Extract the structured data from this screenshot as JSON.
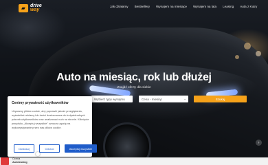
{
  "brand": {
    "line1": "drive",
    "line2": "way"
  },
  "nav": {
    "items": [
      {
        "label": "Jak działamy"
      },
      {
        "label": "Bestsellery"
      },
      {
        "label": "Wynajem na miesiące"
      },
      {
        "label": "Wynajem na lata"
      },
      {
        "label": "Leasing"
      },
      {
        "label": "Auta z Kutry"
      }
    ]
  },
  "hero": {
    "title": "Auto na miesiąc, rok lub dłużej",
    "subtitle": "Znajdź oferty dla siebie"
  },
  "search": {
    "type_placeholder": "Wybierz typy wynajmu",
    "price_placeholder": "Cena - miesiąc",
    "button_label": "Szukaj"
  },
  "cookies": {
    "title": "Cenimy prywatność użytkowników",
    "text": "Używamy plików cookie, aby poprawić jakość przeglądania, wyświetlać reklamy lub treści dostosowane do indywidualnych potrzeb użytkowników oraz analizować ruch na stronie. Kliknięcie przycisku „Akceptuj wszystkie\" oznacza zgodę na wykorzystywanie przez nas plików cookie.",
    "customize_label": "Dostosuj",
    "reject_label": "Odrzuć",
    "accept_label": "Akceptuj wszystkie"
  },
  "footer_badge": {
    "line1": "Ocena",
    "line2": "Autoleasing"
  },
  "colors": {
    "accent": "#f6a21a",
    "primary_button": "#1f5cc9"
  }
}
